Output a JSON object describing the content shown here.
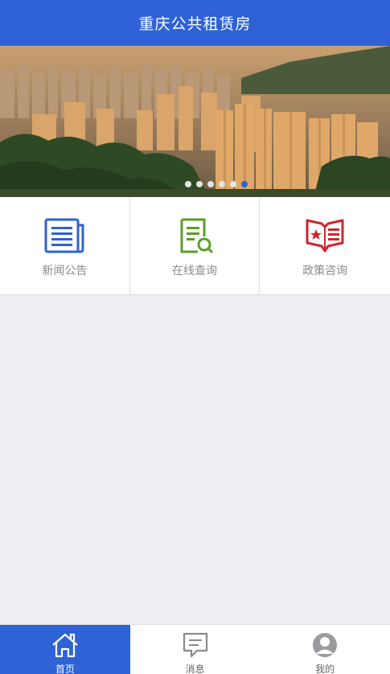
{
  "header": {
    "title": "重庆公共租赁房"
  },
  "banner": {
    "slide_count": 6,
    "active_index": 5
  },
  "menu": {
    "items": [
      {
        "label": "新闻公告",
        "icon": "newspaper-icon",
        "color": "#2e62d6"
      },
      {
        "label": "在线查询",
        "icon": "search-document-icon",
        "color": "#5a9e2a"
      },
      {
        "label": "政策咨询",
        "icon": "policy-book-icon",
        "color": "#d0242e"
      }
    ]
  },
  "tabbar": {
    "items": [
      {
        "label": "首页",
        "icon": "home-icon",
        "active": true
      },
      {
        "label": "消息",
        "icon": "message-icon",
        "active": false
      },
      {
        "label": "我的",
        "icon": "user-icon",
        "active": false
      }
    ]
  },
  "colors": {
    "primary": "#2e62d6",
    "background": "#eeeff4"
  }
}
